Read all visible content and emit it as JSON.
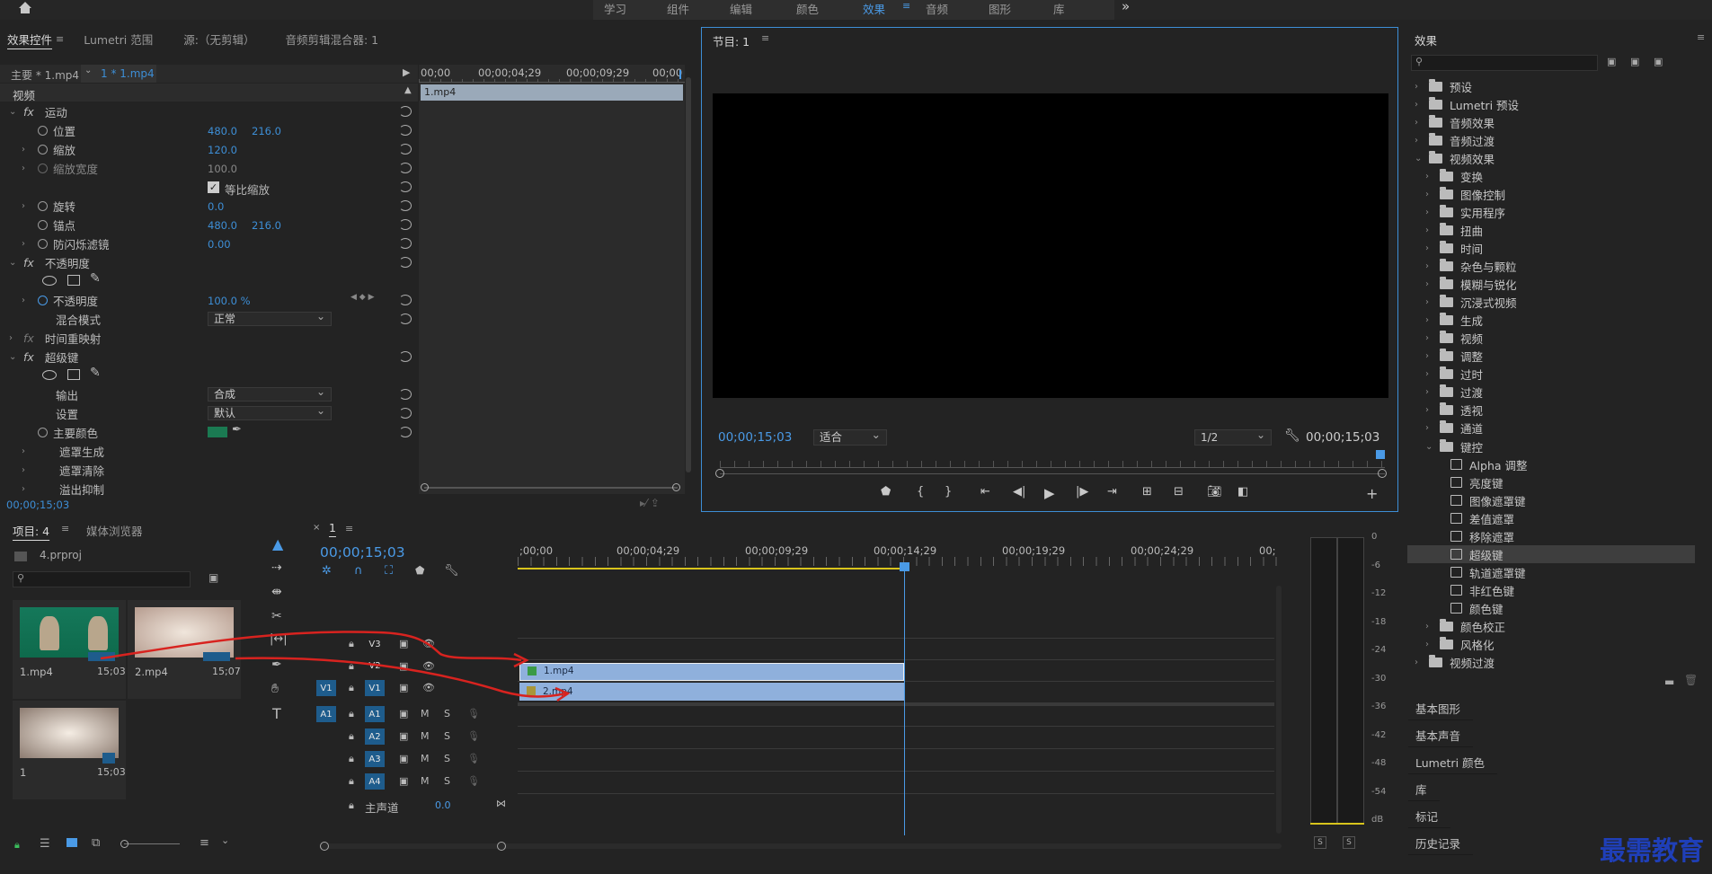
{
  "top_nav": {
    "home_icon": "home-icon",
    "tabs": [
      "学习",
      "组件",
      "编辑",
      "颜色",
      "效果",
      "音频",
      "图形",
      "库"
    ],
    "active": "效果",
    "more": "»"
  },
  "effect_controls": {
    "tabs": [
      "效果控件",
      "Lumetri 范围",
      "源:（无剪辑）",
      "音频剪辑混合器: 1"
    ],
    "master_clip": "主要 * 1.mp4",
    "sequence_clip": "1 * 1.mp4",
    "ruler": [
      "00;00",
      "00;00;04;29",
      "00;00;09;29",
      "00;00"
    ],
    "clip_bar": "1.mp4",
    "section_video": "视频",
    "motion": {
      "label": "运动",
      "position": "位置",
      "pos_x": "480.0",
      "pos_y": "216.0",
      "scale": "缩放",
      "scale_val": "120.0",
      "scale_width": "缩放宽度",
      "scale_width_val": "100.0",
      "uniform": "等比缩放",
      "rotation": "旋转",
      "rotation_val": "0.0",
      "anchor": "锚点",
      "anchor_x": "480.0",
      "anchor_y": "216.0",
      "flicker": "防闪烁滤镜",
      "flicker_val": "0.00"
    },
    "opacity": {
      "label": "不透明度",
      "opacity": "不透明度",
      "opacity_val": "100.0 %",
      "blend": "混合模式",
      "blend_val": "正常"
    },
    "time_remap": "时间重映射",
    "ultra_key": {
      "label": "超级键",
      "output": "输出",
      "output_val": "合成",
      "setting": "设置",
      "setting_val": "默认",
      "key_color": "主要颜色",
      "key_color_hex": "#1b7a52",
      "matte_gen": "遮罩生成",
      "matte_clean": "遮罩清除",
      "spill": "溢出抑制"
    },
    "timecode": "00;00;15;03"
  },
  "program": {
    "title": "节目: 1",
    "timecode": "00;00;15;03",
    "fit": "适合",
    "resolution": "1/2",
    "duration": "00;00;15;03"
  },
  "effects_panel": {
    "title": "效果",
    "tree": [
      {
        "label": "预设",
        "level": 0,
        "type": "folder",
        "open": false
      },
      {
        "label": "Lumetri 预设",
        "level": 0,
        "type": "folder",
        "open": false
      },
      {
        "label": "音频效果",
        "level": 0,
        "type": "folder",
        "open": false
      },
      {
        "label": "音频过渡",
        "level": 0,
        "type": "folder",
        "open": false
      },
      {
        "label": "视频效果",
        "level": 0,
        "type": "folder",
        "open": true
      },
      {
        "label": "变换",
        "level": 1,
        "type": "folder",
        "open": false
      },
      {
        "label": "图像控制",
        "level": 1,
        "type": "folder",
        "open": false
      },
      {
        "label": "实用程序",
        "level": 1,
        "type": "folder",
        "open": false
      },
      {
        "label": "扭曲",
        "level": 1,
        "type": "folder",
        "open": false
      },
      {
        "label": "时间",
        "level": 1,
        "type": "folder",
        "open": false
      },
      {
        "label": "杂色与颗粒",
        "level": 1,
        "type": "folder",
        "open": false
      },
      {
        "label": "模糊与锐化",
        "level": 1,
        "type": "folder",
        "open": false
      },
      {
        "label": "沉浸式视频",
        "level": 1,
        "type": "folder",
        "open": false
      },
      {
        "label": "生成",
        "level": 1,
        "type": "folder",
        "open": false
      },
      {
        "label": "视频",
        "level": 1,
        "type": "folder",
        "open": false
      },
      {
        "label": "调整",
        "level": 1,
        "type": "folder",
        "open": false
      },
      {
        "label": "过时",
        "level": 1,
        "type": "folder",
        "open": false
      },
      {
        "label": "过渡",
        "level": 1,
        "type": "folder",
        "open": false
      },
      {
        "label": "透视",
        "level": 1,
        "type": "folder",
        "open": false
      },
      {
        "label": "通道",
        "level": 1,
        "type": "folder",
        "open": false
      },
      {
        "label": "键控",
        "level": 1,
        "type": "folder",
        "open": true
      },
      {
        "label": "Alpha 调整",
        "level": 2,
        "type": "effect"
      },
      {
        "label": "亮度键",
        "level": 2,
        "type": "effect"
      },
      {
        "label": "图像遮罩键",
        "level": 2,
        "type": "effect"
      },
      {
        "label": "差值遮罩",
        "level": 2,
        "type": "effect"
      },
      {
        "label": "移除遮罩",
        "level": 2,
        "type": "effect"
      },
      {
        "label": "超级键",
        "level": 2,
        "type": "effect",
        "selected": true
      },
      {
        "label": "轨道遮罩键",
        "level": 2,
        "type": "effect"
      },
      {
        "label": "非红色键",
        "level": 2,
        "type": "effect"
      },
      {
        "label": "颜色键",
        "level": 2,
        "type": "effect"
      },
      {
        "label": "颜色校正",
        "level": 1,
        "type": "folder",
        "open": false
      },
      {
        "label": "风格化",
        "level": 1,
        "type": "folder",
        "open": false
      },
      {
        "label": "视频过渡",
        "level": 0,
        "type": "folder",
        "open": false
      }
    ],
    "side_panels": [
      "基本图形",
      "基本声音",
      "Lumetri 颜色",
      "库",
      "标记",
      "历史记录"
    ]
  },
  "project": {
    "tabs": [
      "项目: 4",
      "媒体浏览器"
    ],
    "file": "4.prproj",
    "items": [
      {
        "name": "1.mp4",
        "dur": "15;03"
      },
      {
        "name": "2.mp4",
        "dur": "15;07"
      },
      {
        "name": "1",
        "dur": "15;03"
      }
    ]
  },
  "timeline": {
    "seq": "1",
    "timecode": "00;00;15;03",
    "ruler": [
      ";00;00",
      "00;00;04;29",
      "00;00;09;29",
      "00;00;14;29",
      "00;00;19;29",
      "00;00;24;29",
      "00;"
    ],
    "tracks_video": [
      "V3",
      "V2",
      "V1"
    ],
    "tracks_audio": [
      "A1",
      "A2",
      "A3",
      "A4"
    ],
    "src_v": "V1",
    "src_a": "A1",
    "clip_v2": "1.mp4",
    "clip_v1": "2.mp4",
    "master": "主声道",
    "master_val": "0.0",
    "m": "M",
    "s": "S"
  },
  "meter": {
    "scale": [
      "0",
      "-6",
      "-12",
      "-18",
      "-24",
      "-30",
      "-36",
      "-42",
      "-48",
      "-54",
      "dB"
    ],
    "solo": "S"
  },
  "watermark": "最需教育"
}
